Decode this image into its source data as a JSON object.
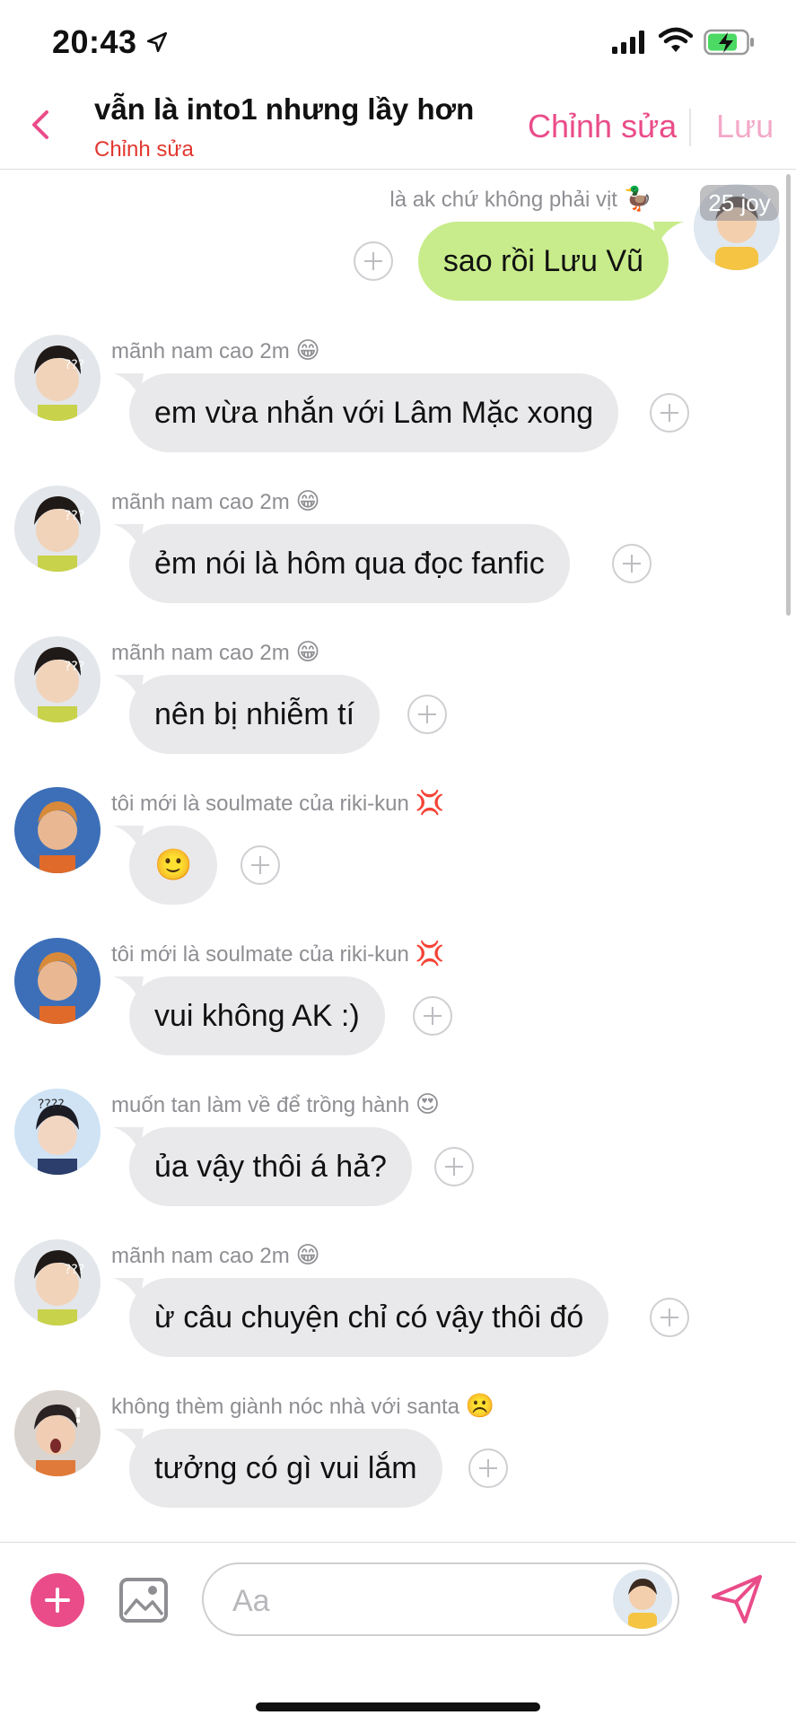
{
  "status_bar": {
    "time": "20:43"
  },
  "header": {
    "title": "vẫn là into1 nhưng lầy hơn",
    "subtitle": "Chỉnh sửa",
    "edit_label": "Chỉnh sửa",
    "save_label": "Lưu"
  },
  "my_message": {
    "name": "là ak chứ không phải vịt",
    "name_emoji": "🦆",
    "badge": "25 joy",
    "text": "sao rồi Lưu Vũ"
  },
  "messages": [
    {
      "name": "mãnh nam cao 2m",
      "emoji": "😁",
      "text": "em vừa nhắn với Lâm Mặc xong"
    },
    {
      "name": "mãnh nam cao 2m",
      "emoji": "😁",
      "text": "ẻm nói là hôm qua đọc fanfic"
    },
    {
      "name": "mãnh nam cao 2m",
      "emoji": "😁",
      "text": "nên bị nhiễm tí"
    },
    {
      "name": "tôi mới là soulmate của riki-kun",
      "emoji": "💢",
      "text": "🙂"
    },
    {
      "name": "tôi mới là soulmate của riki-kun",
      "emoji": "💢",
      "text": "vui không AK :)"
    },
    {
      "name": "muốn tan làm về để trồng hành",
      "emoji": "😍",
      "text": "ủa vậy thôi á hả?"
    },
    {
      "name": "mãnh nam cao 2m",
      "emoji": "😁",
      "text": "ừ câu chuyện chỉ có vậy thôi đó"
    },
    {
      "name": "không thèm giành nóc nhà với santa",
      "emoji": "☹️",
      "text": "tưởng có gì vui lắm"
    }
  ],
  "composer": {
    "placeholder": "Aa"
  },
  "colors": {
    "accent": "#ea4c89",
    "my_bubble": "#c8ec8b",
    "other_bubble": "#e9e9eb",
    "subtitle": "#e2382f"
  }
}
